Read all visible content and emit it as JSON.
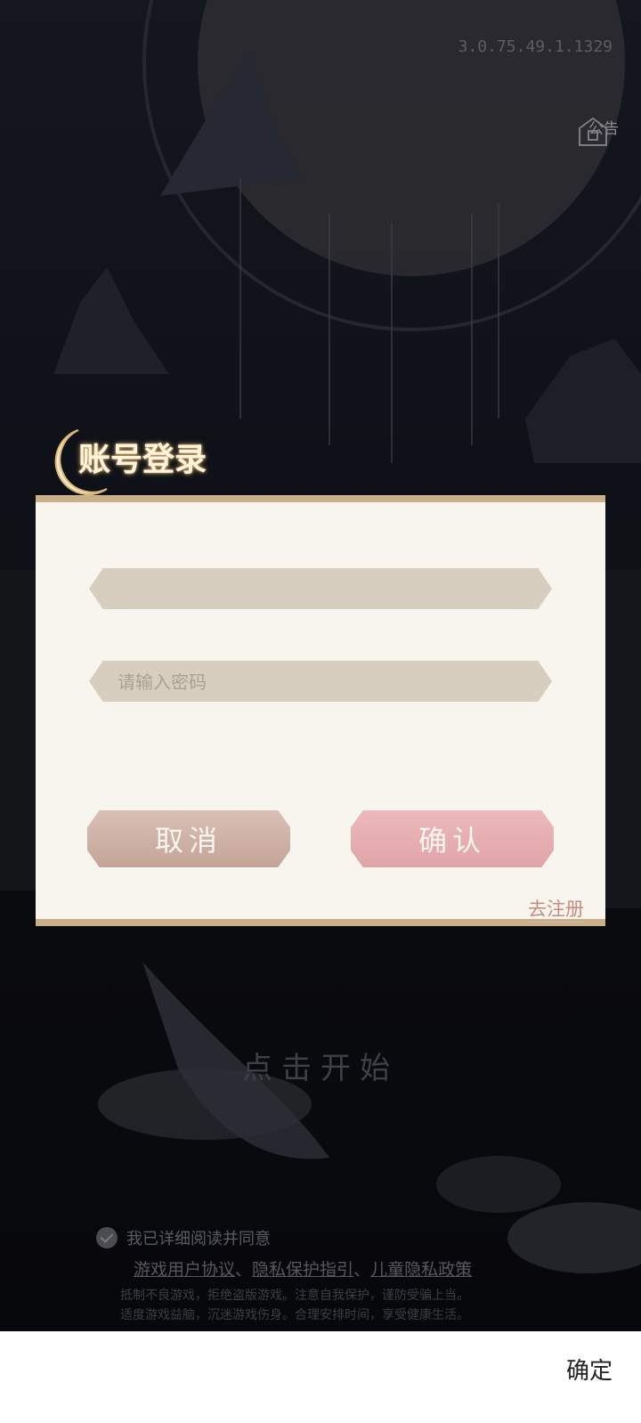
{
  "header": {
    "version": "3.0.75.49.1.1329",
    "notice_label": "公告"
  },
  "dialog": {
    "title": "账号登录",
    "account_value": "",
    "password_placeholder": "请输入密码",
    "cancel_label": "取消",
    "confirm_label": "确认",
    "register_label": "去注册"
  },
  "start_label": "点击开始",
  "agreement": {
    "text": "我已详细阅读并同意",
    "links": [
      "游戏用户协议",
      "隐私保护指引",
      "儿童隐私政策"
    ],
    "separator": "、",
    "health_notice": [
      "抵制不良游戏，拒绝盗版游戏。注意自我保护，谨防受骗上当。",
      "适度游戏益脑，沉迷游戏伤身。合理安排时间，享受健康生活。"
    ]
  },
  "bottom_bar": {
    "ok_label": "确定"
  },
  "colors": {
    "panel": "#f8f5ef",
    "cancel": "#c9aa9f",
    "confirm": "#e3a9ac",
    "register": "#c98b80"
  }
}
